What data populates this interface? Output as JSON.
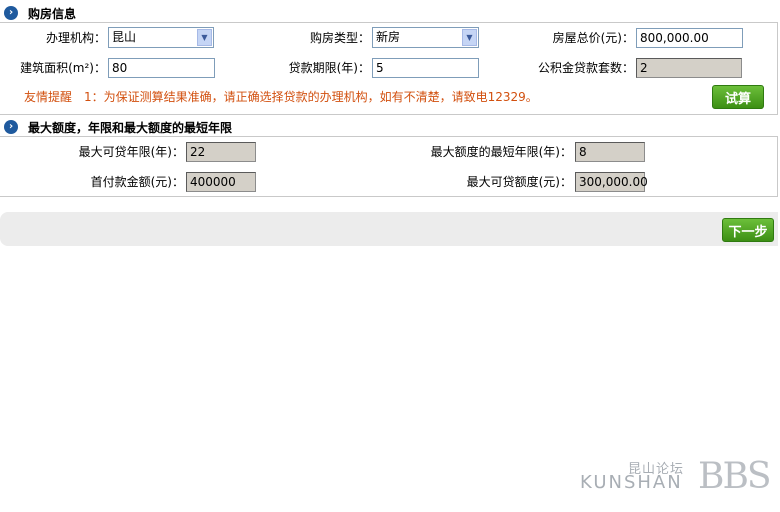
{
  "section1": {
    "title": "购房信息",
    "office_label": "办理机构：",
    "office_value": "昆山",
    "house_type_label": "购房类型：",
    "house_type_value": "新房",
    "total_price_label": "房屋总价(元)：",
    "total_price_value": "800,000.00",
    "area_label": "建筑面积(m²)：",
    "area_value": "80",
    "loan_term_label": "贷款期限(年)：",
    "loan_term_value": "5",
    "fund_loan_count_label": "公积金贷款套数：",
    "fund_loan_count_value": "2",
    "tip": "友情提醒　1：为保证测算结果准确，请正确选择贷款的办理机构，如有不清楚，请致电12329。",
    "calc_button": "试算"
  },
  "section2": {
    "title": "最大额度，年限和最大额度的最短年限",
    "max_years_label": "最大可贷年限(年)：",
    "max_years_value": "22",
    "min_years_label": "最大额度的最短年限(年)：",
    "min_years_value": "8",
    "down_payment_label": "首付款金额(元)：",
    "down_payment_value": "400000",
    "max_amount_label": "最大可贷额度(元)：",
    "max_amount_value": "300,000.00"
  },
  "next_button": "下一步",
  "watermark": {
    "cn": "昆山论坛",
    "en": "KUNSHAN",
    "bbs": "BBS"
  },
  "icons": {
    "section_bullet": "chevron-right-circle-icon",
    "dropdown": "chevron-down-icon"
  }
}
